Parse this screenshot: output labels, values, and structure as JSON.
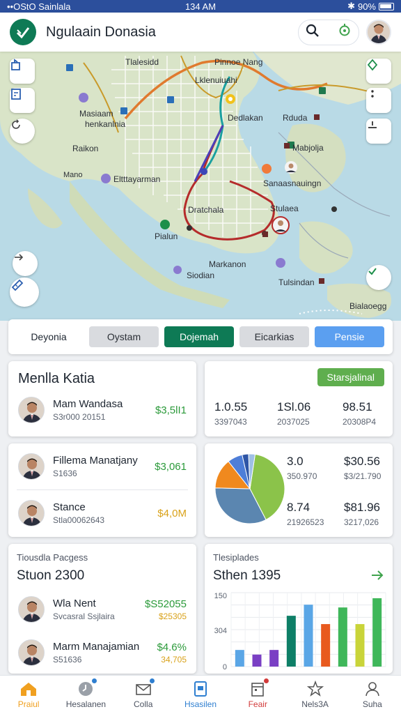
{
  "status_bar": {
    "left": "••OStO Sainlala",
    "time": "134 AM",
    "battery": "90%"
  },
  "header": {
    "title": "Ngulaain Donasia"
  },
  "map": {
    "labels": [
      {
        "text": "Tlalesidd",
        "name": "map-label-tlalesidd"
      },
      {
        "text": "Pinnoe Nang",
        "name": "map-label-pinnoe-nang"
      },
      {
        "text": "Lklenuiuahi",
        "name": "map-label-lklenuiuahi"
      },
      {
        "text": "Masiaam",
        "name": "map-label-masiaam"
      },
      {
        "text": "henkanlnia",
        "name": "map-label-henkanlnia"
      },
      {
        "text": "Dedlakan",
        "name": "map-label-dedlakan"
      },
      {
        "text": "Rduda",
        "name": "map-label-rduda"
      },
      {
        "text": "Raikon",
        "name": "map-label-raikon"
      },
      {
        "text": "Mabjolja",
        "name": "map-label-mabjolja"
      },
      {
        "text": "Mano",
        "name": "map-label-mano"
      },
      {
        "text": "Eltttayarman",
        "name": "map-label-eltttayarman"
      },
      {
        "text": "Sanaasnauingn",
        "name": "map-label-sanaasnauingn"
      },
      {
        "text": "Dratchala",
        "name": "map-label-dratchala"
      },
      {
        "text": "Stulaea",
        "name": "map-label-stulaea"
      },
      {
        "text": "Pialun",
        "name": "map-label-pialun"
      },
      {
        "text": "Markanon",
        "name": "map-label-markanon"
      },
      {
        "text": "Siodian",
        "name": "map-label-siodian"
      },
      {
        "text": "Tulsindan",
        "name": "map-label-tulsindan"
      },
      {
        "text": "Bialaoegg",
        "name": "map-label-bialaoegg"
      }
    ]
  },
  "segments": {
    "first": "Deyonia",
    "items": [
      {
        "label": "Oystam"
      },
      {
        "label": "Dojemah"
      },
      {
        "label": "Eicarkias"
      },
      {
        "label": "Pensie"
      }
    ]
  },
  "card1": {
    "title": "Menlla Katia",
    "people": [
      {
        "name": "Mam Wandasa",
        "sub": "S3r000 20151",
        "amount": "$3,5lI1"
      }
    ]
  },
  "card2": {
    "badge": "Starsjalinal",
    "stats": [
      {
        "value": "1.0.55",
        "sub": "3397043"
      },
      {
        "value": "1Sl.06",
        "sub": "2037025"
      },
      {
        "value": "98.51",
        "sub": "20308P4"
      }
    ]
  },
  "card3": {
    "people": [
      {
        "name": "Fillema Manatjany",
        "sub": "S1636",
        "amount": "$3,061"
      },
      {
        "name": "Stance",
        "sub": "Stla00062643",
        "amount": "$4,0M"
      }
    ]
  },
  "card4": {
    "stats": [
      {
        "value": "3.0",
        "sub": "350.970"
      },
      {
        "value": "$30.56",
        "sub": "$3/21.790"
      },
      {
        "value": "8.74",
        "sub": "21926523"
      },
      {
        "value": "$81.96",
        "sub": "3217,026"
      }
    ]
  },
  "card5": {
    "label": "Tiousdla Pacgess",
    "title": "Stuon 2300",
    "people": [
      {
        "name": "Wla Nent",
        "sub": "Svcasral Ssjlaira",
        "amount": "$S52055",
        "amount2": "$25305"
      },
      {
        "name": "Marm Manajamian",
        "sub": "S51636",
        "amount": "$4.6%",
        "amount2": "34,705"
      }
    ]
  },
  "card6": {
    "label": "Tlesiplades",
    "title": "Sthen 1395"
  },
  "chart_data": [
    {
      "type": "pie",
      "slices": [
        {
          "value": 40,
          "color": "#8bc34a"
        },
        {
          "value": 33,
          "color": "#5b86b0"
        },
        {
          "value": 14,
          "color": "#f0891e"
        },
        {
          "value": 7,
          "color": "#4e7ed8"
        },
        {
          "value": 3,
          "color": "#2e55a6"
        },
        {
          "value": 3,
          "color": "#9fc0e6"
        }
      ]
    },
    {
      "type": "bar",
      "y_ticks": [
        "150",
        "304",
        "0"
      ],
      "values": [
        18,
        13,
        18,
        55,
        67,
        46,
        64,
        46,
        74
      ],
      "colors": [
        "#5aa6e6",
        "#7a3fc4",
        "#7a3fc4",
        "#0e7f67",
        "#5aa6e6",
        "#e85a1e",
        "#3fb75a",
        "#c9d43a",
        "#3fb75a"
      ]
    }
  ],
  "bottom_nav": [
    {
      "label": "Praiul",
      "icon": "home-icon"
    },
    {
      "label": "Hesalanen",
      "icon": "chat-icon"
    },
    {
      "label": "Colla",
      "icon": "mail-icon"
    },
    {
      "label": "Hsasilen",
      "icon": "document-icon"
    },
    {
      "label": "Feair",
      "icon": "calendar-icon"
    },
    {
      "label": "Nels3A",
      "icon": "star-icon"
    },
    {
      "label": "Suha",
      "icon": "profile-icon"
    }
  ],
  "colors": {
    "accent": "#0e7a55",
    "green_amount": "#2b9a3a",
    "yellow_amount": "#d9a21a",
    "active_nav": "#f0a020",
    "active_nav_blue": "#2f7fd0"
  }
}
